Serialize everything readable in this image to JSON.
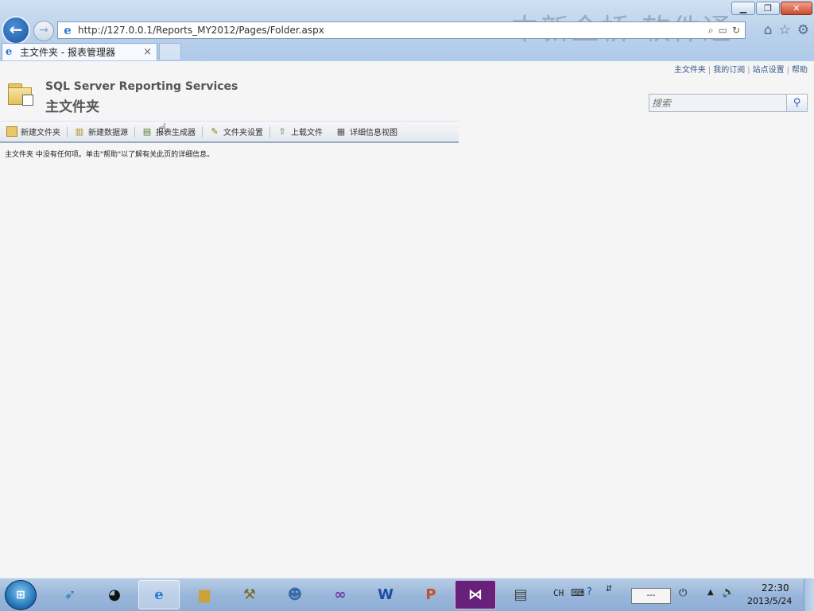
{
  "browser": {
    "url_host": "http://127.0.0.1",
    "url_path": "/Reports_MY2012/Pages/Folder.aspx",
    "watermark": "中新金桥 软件通",
    "tab_title": "主文件夹 - 报表管理器",
    "tab_close": "×",
    "buttons": {
      "minimize": "▁",
      "restore": "❐",
      "close": "✕",
      "back": "←",
      "forward": "→"
    },
    "icons": [
      "home-icon",
      "favorites-star-icon",
      "settings-gear-icon"
    ]
  },
  "page": {
    "top_links": [
      "主文件夹",
      "我的订阅",
      "站点设置",
      "帮助"
    ],
    "product": "SQL Server Reporting Services",
    "title": "主文件夹",
    "search_placeholder": "搜索",
    "toolbar": [
      {
        "label": "新建文件夹",
        "icon": "new-folder-icon"
      },
      {
        "label": "新建数据源",
        "icon": "new-datasource-icon"
      },
      {
        "label": "报表生成器",
        "icon": "report-builder-icon"
      },
      {
        "label": "文件夹设置",
        "icon": "folder-settings-icon"
      },
      {
        "label": "上载文件",
        "icon": "upload-file-icon"
      },
      {
        "label": "详细信息视图",
        "icon": "details-view-icon"
      }
    ],
    "status_text": "主文件夹 中没有任何项。单击\"帮助\"以了解有关此页的详细信息。"
  },
  "taskbar": {
    "apps": [
      "start-icon",
      "app-bird-icon",
      "qq-icon",
      "internet-explorer-icon",
      "file-explorer-icon",
      "tools-icon",
      "network-user-icon",
      "visual-studio-infinity-icon",
      "word-icon",
      "powerpoint-icon",
      "visual-studio-icon",
      "report-file-icon"
    ],
    "lang": "CH",
    "tray_box": "---",
    "time": "22:30",
    "date": "2013/5/24"
  }
}
